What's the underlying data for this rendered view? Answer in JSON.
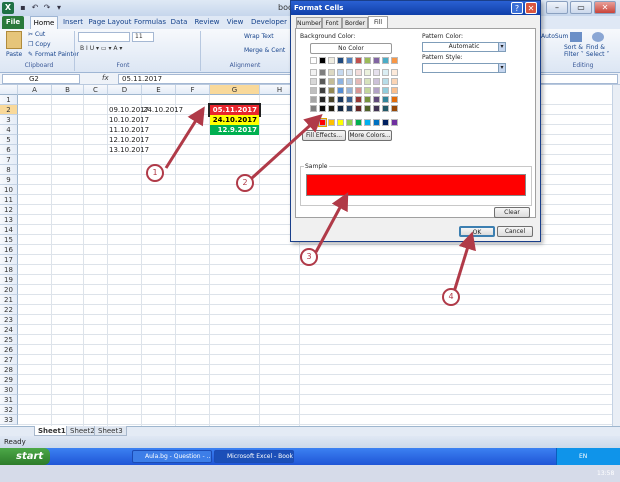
{
  "window": {
    "title": "book1 - Microsoft Excel",
    "title_visible": "book"
  },
  "ribbon": {
    "tabs": [
      "File",
      "Home",
      "Insert",
      "Page Layout",
      "Formulas",
      "Data",
      "Review",
      "View",
      "Developer"
    ],
    "clipboard": {
      "paste": "Paste",
      "cut": "Cut",
      "copy": "Copy",
      "format_painter": "Format Painter",
      "group_label": "Clipboard"
    },
    "font": {
      "size": "11",
      "group_label": "Font"
    },
    "alignment": {
      "wrap_text": "Wrap Text",
      "merge_center": "Merge & Cent",
      "group_label": "Alignment"
    },
    "editing": {
      "autosum": "AutoSum",
      "sort_filter": "Sort &\nFilter",
      "find_select": "Find &\nSelect",
      "group_label": "Editing",
      "sort_label": "Sort &",
      "sort_label2": "Filter ˅",
      "find_label": "Find &",
      "find_label2": "Select ˅"
    }
  },
  "formula_bar": {
    "name_box": "G2",
    "fx": "fx",
    "value": "05.11.2017"
  },
  "grid": {
    "columns": [
      "A",
      "B",
      "C",
      "D",
      "E",
      "F",
      "G",
      "H"
    ],
    "rows": [
      "1",
      "2",
      "3",
      "4",
      "5",
      "6",
      "7",
      "8",
      "9",
      "10",
      "11",
      "12",
      "13",
      "14",
      "15",
      "16",
      "17",
      "18",
      "19",
      "20",
      "21",
      "22",
      "23",
      "24",
      "25",
      "26",
      "27",
      "28",
      "29",
      "30",
      "31",
      "32",
      "33"
    ],
    "cells": {
      "D2": "09.10.2017",
      "E2": "24.10.2017",
      "D3": "10.10.2017",
      "D4": "11.10.2017",
      "D5": "12.10.2017",
      "D6": "13.10.2017",
      "G2": "05.11.2017",
      "G3": "24.10.2017",
      "G4": "12.9.2017"
    },
    "cell_colors": {
      "G2": "#e8262d",
      "G3": "#ffff00",
      "G4": "#00b050"
    }
  },
  "sheets": [
    "Sheet1",
    "Sheet2",
    "Sheet3"
  ],
  "status": "Ready",
  "taskbar": {
    "start": "start",
    "items": [
      "Aula.bg - Question - ...",
      "Microsoft Excel - Book1"
    ],
    "lang": "EN",
    "clock": "13:58"
  },
  "dialog": {
    "title": "Format Cells",
    "tabs": [
      "Number",
      "Font",
      "Border",
      "Fill"
    ],
    "active_tab": "Fill",
    "background_color_label": "Background Color:",
    "no_color": "No Color",
    "fill_effects": "Fill Effects...",
    "more_colors": "More Colors...",
    "pattern_color_label": "Pattern Color:",
    "pattern_color_value": "Automatic",
    "pattern_style_label": "Pattern Style:",
    "sample_label": "Sample",
    "sample_color": "#ff0000",
    "clear": "Clear",
    "ok": "OK",
    "cancel": "Cancel",
    "theme_colors": [
      [
        "#ffffff",
        "#000000",
        "#eeece1",
        "#1f497d",
        "#4f81bd",
        "#c0504d",
        "#9bbb59",
        "#8064a2",
        "#4bacc6",
        "#f79646"
      ],
      [
        "#f2f2f2",
        "#7f7f7f",
        "#ddd9c3",
        "#c6d9f0",
        "#dbe5f1",
        "#f2dcdb",
        "#ebf1dd",
        "#e5e0ec",
        "#dbeef3",
        "#fdeada"
      ],
      [
        "#d8d8d8",
        "#595959",
        "#c4bd97",
        "#8db3e2",
        "#b8cce4",
        "#e5b9b7",
        "#d7e3bc",
        "#ccc1d9",
        "#b7dde8",
        "#fbd5b5"
      ],
      [
        "#bfbfbf",
        "#3f3f3f",
        "#938953",
        "#548dd4",
        "#95b3d7",
        "#d99694",
        "#c3d69b",
        "#b2a2c7",
        "#92cddc",
        "#fac08f"
      ],
      [
        "#a5a5a5",
        "#262626",
        "#494429",
        "#17365d",
        "#366092",
        "#953734",
        "#76923c",
        "#5f497a",
        "#31859b",
        "#e36c09"
      ],
      [
        "#7f7f7f",
        "#0c0c0c",
        "#1d1b10",
        "#0f243e",
        "#244061",
        "#632423",
        "#4f6128",
        "#3f3151",
        "#205867",
        "#974806"
      ]
    ],
    "standard_colors": [
      "#c00000",
      "#ff0000",
      "#ffc000",
      "#ffff00",
      "#92d050",
      "#00b050",
      "#00b0f0",
      "#0070c0",
      "#002060",
      "#7030a0"
    ]
  },
  "annotations": [
    "1",
    "2",
    "3",
    "4"
  ]
}
